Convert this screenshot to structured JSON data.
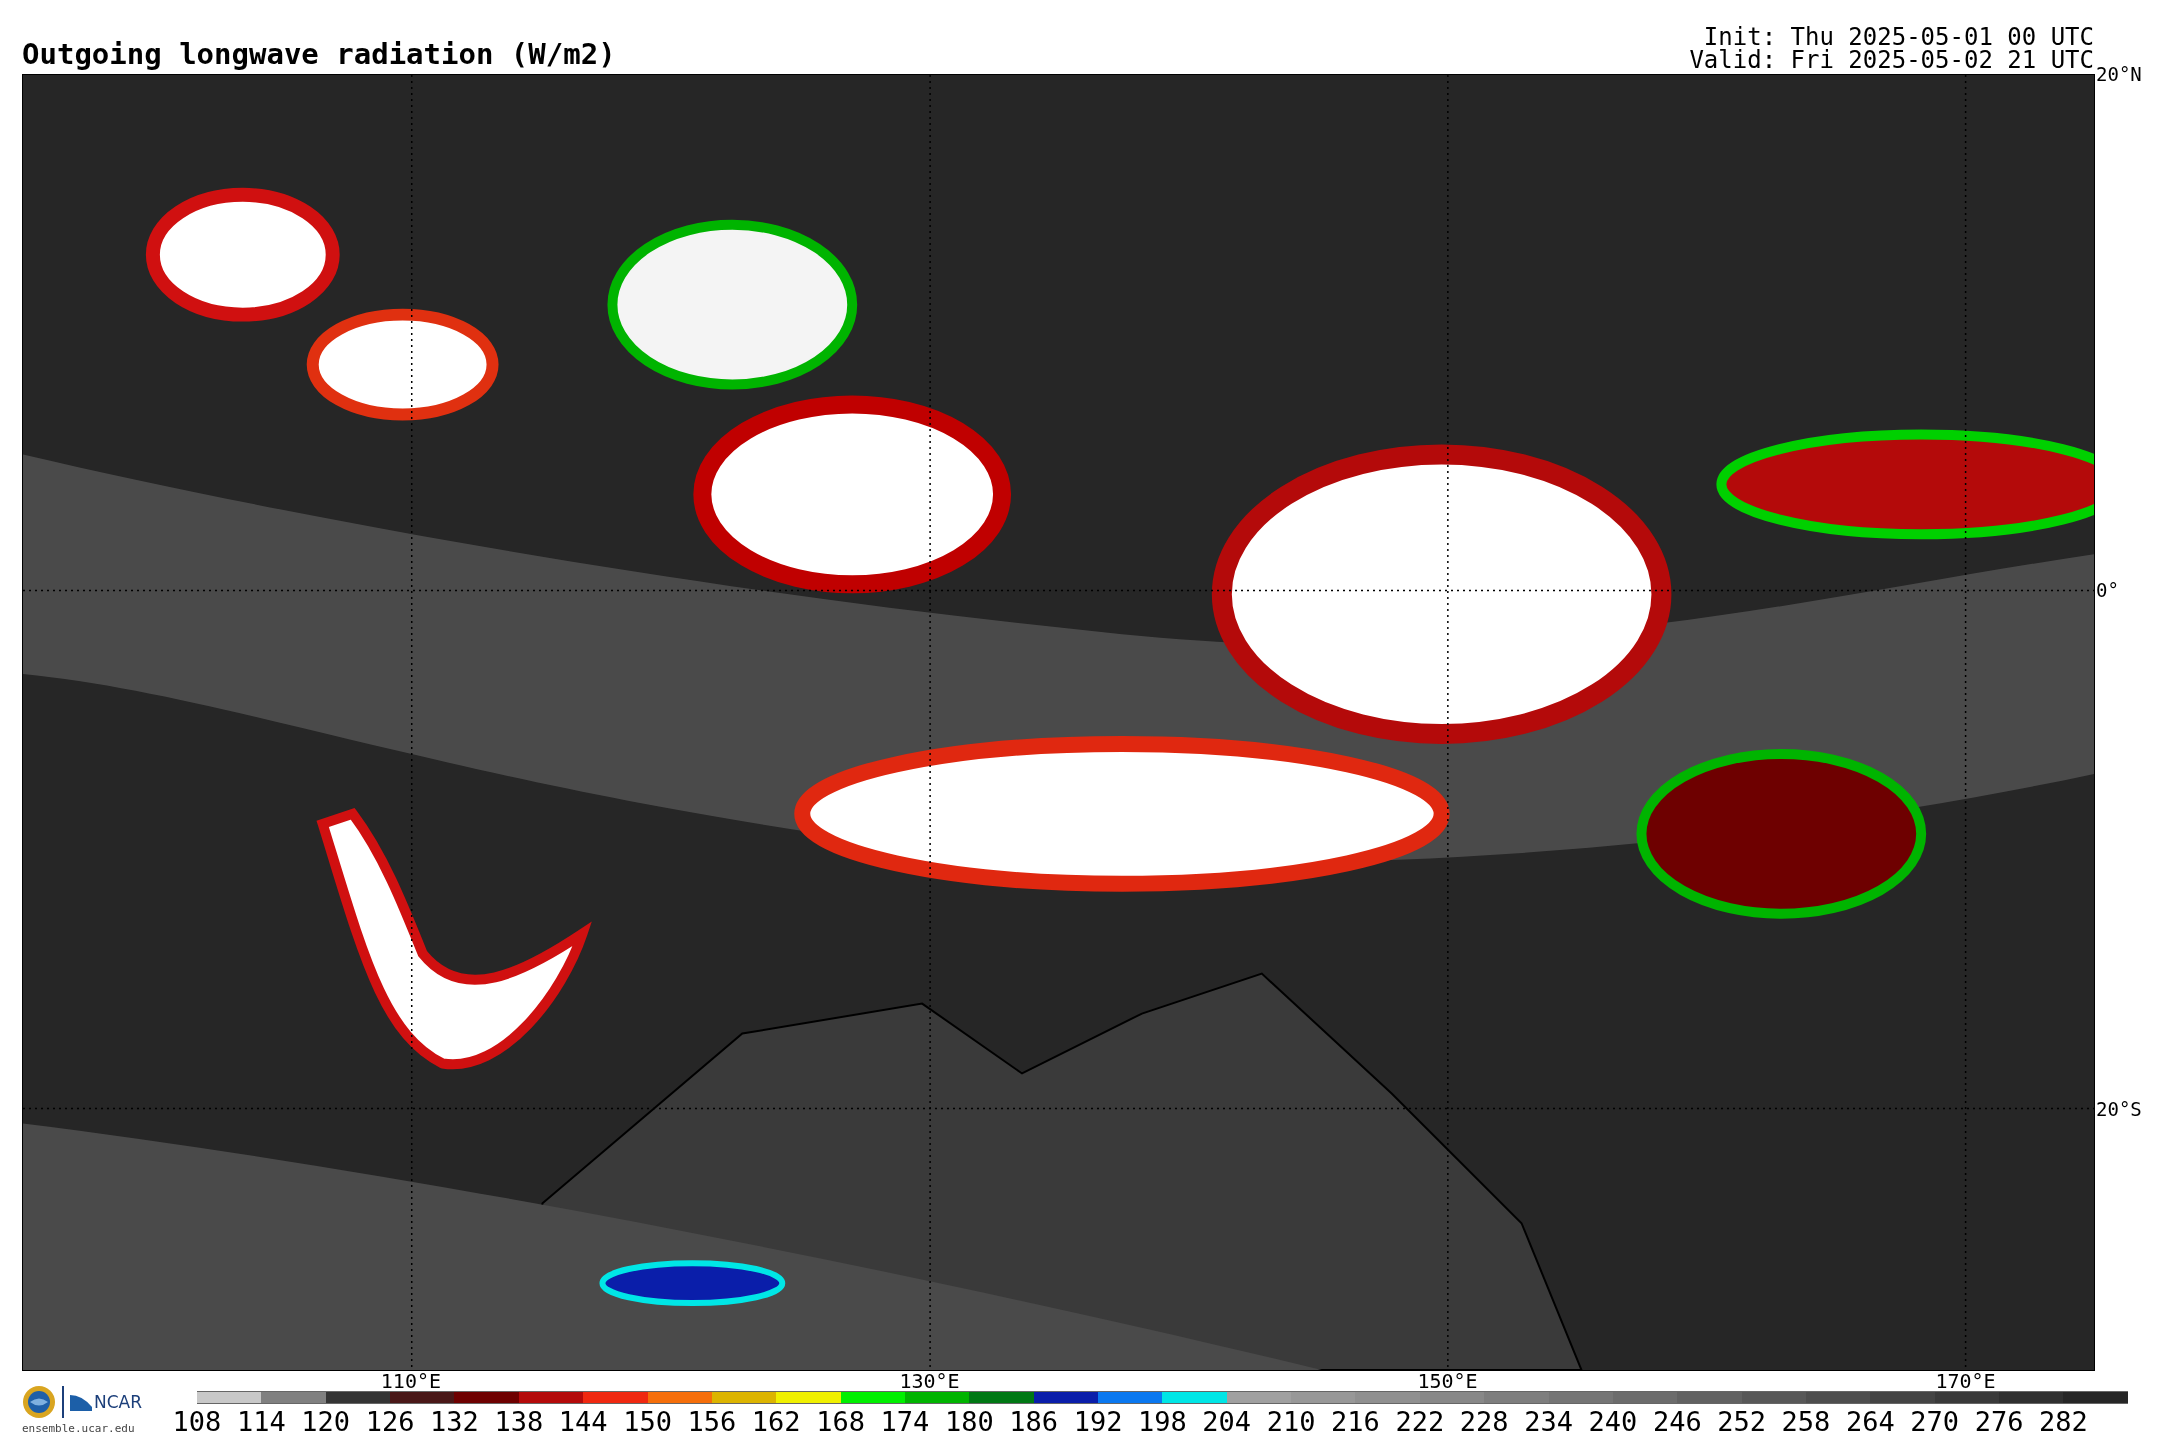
{
  "header": {
    "title": "Outgoing longwave radiation (W/m2)",
    "init": "Init: Thu 2025-05-01 00 UTC",
    "valid": "Valid: Fri 2025-05-02 21 UTC"
  },
  "map": {
    "lat_labels": [
      "20°N",
      "0°",
      "20°S"
    ],
    "lon_labels": [
      "110°E",
      "130°E",
      "150°E",
      "170°E"
    ]
  },
  "footer": {
    "ncar": "NCAR",
    "site": "ensemble.ucar.edu"
  },
  "colorbar": {
    "bins": [
      {
        "label": "108",
        "color": "#c8c8c8"
      },
      {
        "label": "114",
        "color": "#808080"
      },
      {
        "label": "120",
        "color": "#343434"
      },
      {
        "label": "126",
        "color": "#4a1818"
      },
      {
        "label": "132",
        "color": "#6e0000"
      },
      {
        "label": "138",
        "color": "#b40a0a"
      },
      {
        "label": "144",
        "color": "#f02810"
      },
      {
        "label": "150",
        "color": "#f56e0a"
      },
      {
        "label": "156",
        "color": "#dcb400"
      },
      {
        "label": "162",
        "color": "#f0f000"
      },
      {
        "label": "168",
        "color": "#00f000"
      },
      {
        "label": "174",
        "color": "#00b400"
      },
      {
        "label": "180",
        "color": "#007814"
      },
      {
        "label": "186",
        "color": "#0a1eaa"
      },
      {
        "label": "192",
        "color": "#0a78f0"
      },
      {
        "label": "198",
        "color": "#00e6e6"
      },
      {
        "label": "204",
        "color": "#a0a0a0"
      },
      {
        "label": "210",
        "color": "#989898"
      },
      {
        "label": "216",
        "color": "#909090"
      },
      {
        "label": "222",
        "color": "#888888"
      },
      {
        "label": "228",
        "color": "#7e7e7e"
      },
      {
        "label": "234",
        "color": "#757575"
      },
      {
        "label": "240",
        "color": "#6c6c6c"
      },
      {
        "label": "246",
        "color": "#626262"
      },
      {
        "label": "252",
        "color": "#585858"
      },
      {
        "label": "258",
        "color": "#4e4e4e"
      },
      {
        "label": "264",
        "color": "#444444"
      },
      {
        "label": "270",
        "color": "#3a3a3a"
      },
      {
        "label": "276",
        "color": "#303030"
      },
      {
        "label": "282",
        "color": "#262626"
      }
    ]
  }
}
